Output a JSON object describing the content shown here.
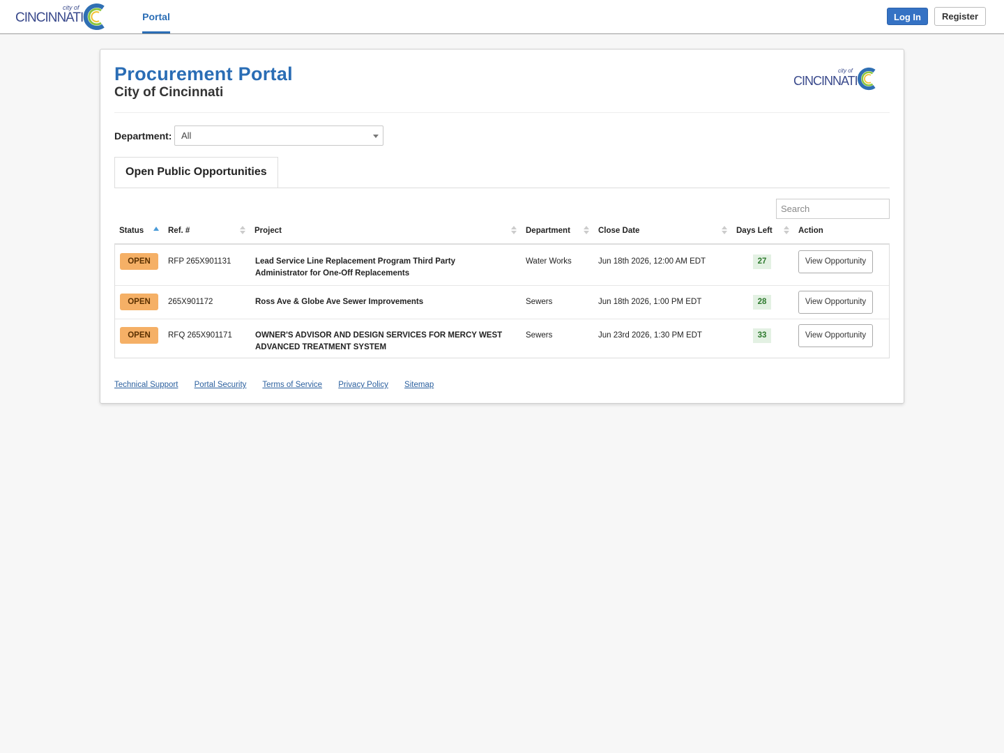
{
  "topbar": {
    "logo_text": "CINCINNATI",
    "logo_cityof": "city of",
    "nav_portal": "Portal",
    "login_label": "Log In",
    "register_label": "Register"
  },
  "card": {
    "title": "Procurement Portal",
    "subtitle": "City of Cincinnati",
    "logo_text": "CINCINNATI",
    "logo_cityof": "city of",
    "department_label": "Department:",
    "department_value": "All",
    "tab_label": "Open Public Opportunities",
    "search_placeholder": "Search"
  },
  "table": {
    "headers": [
      "Status",
      "Ref. #",
      "Project",
      "Department",
      "Close Date",
      "Days Left",
      "Action"
    ],
    "rows": [
      {
        "status": "OPEN",
        "ref": "RFP 265X901131",
        "project_line1": "Lead Service Line Replacement Program Third Party",
        "project_line2": "Administrator for One-Off Replacements",
        "department": "Water Works",
        "close_date": "Jun 18th 2026, 12:00 AM EDT",
        "days_left": "27",
        "action": "View Opportunity"
      },
      {
        "status": "OPEN",
        "ref": "265X901172",
        "project_line1": "Ross Ave & Globe Ave Sewer Improvements",
        "project_line2": "",
        "department": "Sewers",
        "close_date": "Jun 18th 2026, 1:00 PM EDT",
        "days_left": "28",
        "action": "View Opportunity"
      },
      {
        "status": "OPEN",
        "ref": "RFQ 265X901171",
        "project_line1": "OWNER'S ADVISOR AND DESIGN SERVICES FOR MERCY WEST",
        "project_line2": "ADVANCED TREATMENT SYSTEM",
        "department": "Sewers",
        "close_date": "Jun 23rd 2026, 1:30 PM EDT",
        "days_left": "33",
        "action": "View Opportunity"
      }
    ]
  },
  "footer": {
    "links": [
      "Technical Support",
      "Portal Security",
      "Terms of Service",
      "Privacy Policy",
      "Sitemap"
    ]
  },
  "colors": {
    "brand_blue": "#2a6db5",
    "open_badge": "#f5b066",
    "days_badge_bg": "#e3f1e3"
  }
}
